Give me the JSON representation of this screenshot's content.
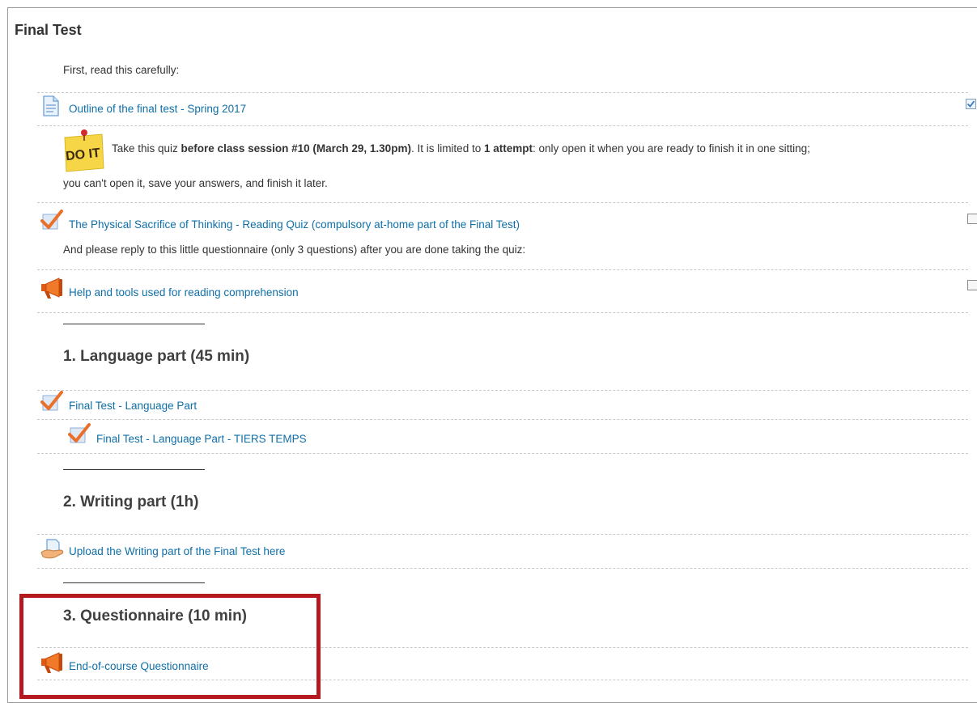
{
  "section": {
    "title": "Final Test"
  },
  "intro": {
    "text": "First, read this carefully:"
  },
  "outline_link": {
    "label": "Outline of the final test - Spring 2017"
  },
  "doit": {
    "badge": "DO IT",
    "t1": "Take this quiz ",
    "b1": "before class session #10 (March 29, 1.30pm)",
    "t2": ". It is limited to ",
    "b2": "1 attempt",
    "t3": ": only open it when you are ready to finish it in one sitting;",
    "line2": "you can't open it, save your answers, and finish it later."
  },
  "reading_quiz": {
    "label": "The Physical Sacrifice of Thinking - Reading Quiz (compulsory at-home part of the Final Test)"
  },
  "questionnaire_note": {
    "text": "And please reply to this little questionnaire (only 3 questions) after you are done taking the quiz:"
  },
  "help_tools": {
    "label": "Help and tools used for reading comprehension"
  },
  "language": {
    "heading": "1. Language part (45 min)",
    "item1": "Final Test - Language Part",
    "item2": "Final Test - Language Part - TIERS TEMPS"
  },
  "writing": {
    "heading": "2. Writing part (1h)",
    "upload": "Upload the Writing part of the Final Test here"
  },
  "questionnaire": {
    "heading": "3. Questionnaire (10 min)",
    "item": "End-of-course Questionnaire"
  },
  "icons": {
    "outline": "page-icon",
    "doit": "sticky-note-icon",
    "quiz": "checkmark-quiz-icon",
    "feedback": "megaphone-icon",
    "assignment": "hand-upload-icon",
    "completion": "completion-checkbox-icon"
  },
  "colors": {
    "link": "#0f6fa8",
    "highlight": "#b3191f",
    "quiz_check": "#e8702a",
    "megaphone": "#e05a12"
  }
}
